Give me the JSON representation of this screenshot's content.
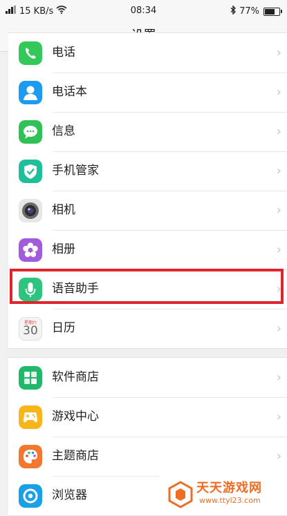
{
  "status_bar": {
    "network_speed": "15 KB/s",
    "time": "08:34",
    "battery_percent": "77%",
    "battery_level": 0.77,
    "signal_icon": "signal-icon",
    "wifi_icon": "wifi-icon",
    "bluetooth_icon": "bluetooth-icon"
  },
  "header": {
    "title": "设置"
  },
  "groups": [
    {
      "items": [
        {
          "label": "电话",
          "icon": "phone-icon",
          "color": "#34c759"
        },
        {
          "label": "电话本",
          "icon": "contacts-icon",
          "color": "#1d9bf0"
        },
        {
          "label": "信息",
          "icon": "messages-icon",
          "color": "#30c256"
        },
        {
          "label": "手机管家",
          "icon": "shield-icon",
          "color": "#1fbf9c"
        },
        {
          "label": "相机",
          "icon": "camera-icon",
          "color": "#6a6a6a"
        },
        {
          "label": "相册",
          "icon": "gallery-icon",
          "color": "#a25bdc"
        },
        {
          "label": "语音助手",
          "icon": "microphone-icon",
          "color": "#2ec47f",
          "highlighted": true
        },
        {
          "label": "日历",
          "icon": "calendar-icon",
          "color": "#e04848",
          "calendar_header": "星期六",
          "calendar_day": "30"
        }
      ]
    },
    {
      "items": [
        {
          "label": "软件商店",
          "icon": "app-store-icon",
          "color": "#21b86b"
        },
        {
          "label": "游戏中心",
          "icon": "gamepad-icon",
          "color": "#f6b61b"
        },
        {
          "label": "主题商店",
          "icon": "palette-icon",
          "color": "#f1782e"
        },
        {
          "label": "浏览器",
          "icon": "browser-icon",
          "color": "#1aa0e6"
        }
      ]
    }
  ],
  "watermark": {
    "name": "天天游戏网",
    "url": "www.ttyl23.com",
    "color": "#ee6d22"
  }
}
